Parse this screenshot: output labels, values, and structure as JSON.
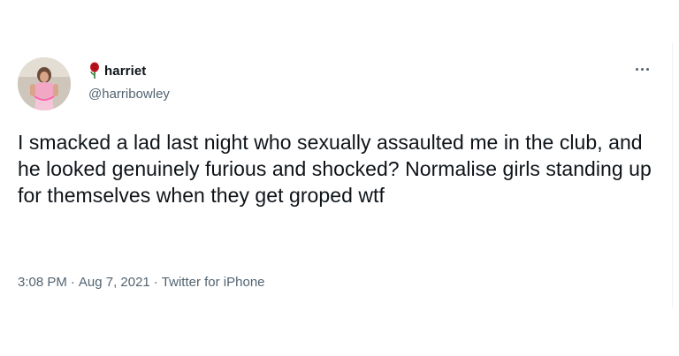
{
  "tweet": {
    "author": {
      "display_name": "harriet",
      "handle": "@harribowley",
      "name_emoji_icon": "rose-icon"
    },
    "text": "I smacked a lad last night who sexually assaulted me in the club, and he looked genuinely furious and shocked? Normalise girls standing up for themselves when they get groped wtf",
    "time": "3:08 PM",
    "date": "Aug 7, 2021",
    "source": "Twitter for iPhone",
    "separator": "·",
    "more_icon": "more-options-icon"
  },
  "colors": {
    "text_primary": "#0f1419",
    "text_secondary": "#536471",
    "rose": "#c0121d"
  }
}
